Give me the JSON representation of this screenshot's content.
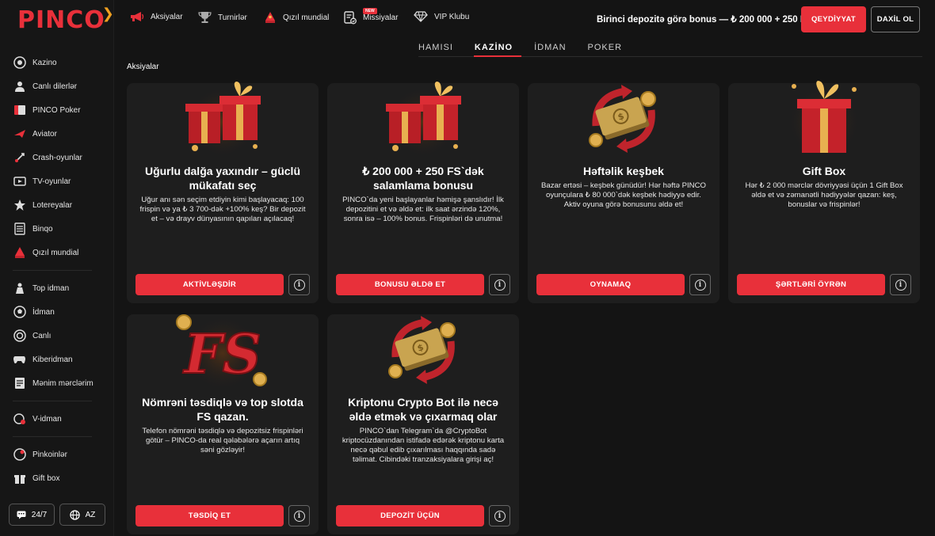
{
  "brand": {
    "logo": "PINCO"
  },
  "sidebar": {
    "items": [
      {
        "label": "Kazino",
        "icon": "casino-chip-icon"
      },
      {
        "label": "Canlı dilerlər",
        "icon": "live-dealer-icon"
      },
      {
        "label": "PINCO Poker",
        "icon": "poker-icon"
      },
      {
        "label": "Aviator",
        "icon": "plane-icon"
      },
      {
        "label": "Crash-oyunlar",
        "icon": "rocket-icon"
      },
      {
        "label": "TV-oyunlar",
        "icon": "tv-icon"
      },
      {
        "label": "Lotereyalar",
        "icon": "lottery-icon"
      },
      {
        "label": "Binqo",
        "icon": "bingo-icon"
      },
      {
        "label": "Qızıl mundial",
        "icon": "trophy-icon"
      },
      {
        "label": "Top idman",
        "icon": "top-sport-icon"
      },
      {
        "label": "İdman",
        "icon": "football-icon"
      },
      {
        "label": "Canlı",
        "icon": "live-icon"
      },
      {
        "label": "Kiberidman",
        "icon": "gamepad-icon"
      },
      {
        "label": "Mənim mərclərim",
        "icon": "bets-list-icon"
      },
      {
        "label": "V-idman",
        "icon": "virtual-sport-icon"
      },
      {
        "label": "Pinkoinlər",
        "icon": "coins-icon"
      },
      {
        "label": "Gift box",
        "icon": "gift-icon"
      }
    ],
    "support_label": "24/7",
    "lang_label": "AZ"
  },
  "header": {
    "nav": [
      {
        "label": "Aksiyalar",
        "icon": "megaphone-icon"
      },
      {
        "label": "Turnirlər",
        "icon": "trophy-icon"
      },
      {
        "label": "Qızıl mundial",
        "icon": "gold-trophy-icon"
      },
      {
        "label": "Missiyalar",
        "icon": "missions-icon",
        "badge": "NEW"
      },
      {
        "label": "VIP Klubu",
        "icon": "diamond-icon"
      }
    ],
    "bonus_text": "Birinci depozitə görə bonus — ₺ 200 000 + 250 FS",
    "register_label": "QEYDİYYAT",
    "login_label": "DAXİL OL"
  },
  "tabs": [
    "HAMISI",
    "KAZİNO",
    "İDMAN",
    "POKER"
  ],
  "active_tab": "KAZİNO",
  "breadcrumb": "Aksiyalar",
  "cards": [
    {
      "title": "Uğurlu dalğa yaxındır – güclü mükafatı seç",
      "text": "Uğur anı sən seçim etdiyin kimi başlayacaq: 100 frispin və ya ₺ 3 700-dək +100% keş? Bir depozit et – və drayv dünyasının qapıları açılacaq!",
      "button": "AKTİVLƏŞDİR",
      "art": "gift-boxes"
    },
    {
      "title": "₺ 200 000 + 250 FS`dək salamlama bonusu",
      "text": "PINCO`da yeni başlayanlar həmişə şanslıdır! İlk depozitini et və əldə et: ilk saat ərzində 120%, sonra isə – 100% bonus. Frispinləri də unutma!",
      "button": "BONUSU ƏLDƏ ET",
      "art": "gift-boxes"
    },
    {
      "title": "Həftəlik keşbek",
      "text": "Bazar ertəsi – keşbek günüdür! Hər həftə PINCO oyunçulara ₺ 80 000`dək keşbek hədiyyə edir. Aktiv oyuna görə bonusunu əldə et!",
      "button": "OYNAMAQ",
      "art": "cash-stack"
    },
    {
      "title": "Gift Box",
      "text": "Hər ₺ 2 000 mərclər dövriyyəsi üçün 1 Gift Box əldə et və zəmanətli hədiyyələr qazan: keş, bonuslar və frispinlər!",
      "button": "ŞƏRTLƏRİ ÖYRƏN",
      "art": "gift-box"
    },
    {
      "title": "Nömrəni təsdiqlə və top slotda FS qazan.",
      "text": "Telefon nömrəni təsdiqlə və depozitsiz frispinləri götür – PINCO-da real qələbələrə açarın artıq səni gözləyir!",
      "button": "TƏSDİQ ET",
      "art": "fs-letters"
    },
    {
      "title": "Kriptonu Crypto Bot ilə necə əldə etmək və çıxarmaq olar",
      "text": "PINCO`dan Telegram`da @CryptoBot kriptocüzdanından istifadə edərək kriptonu karta necə qəbul edib çıxarılması haqqında sadə təlimat. Cibindəki tranzaksiyalara girişi aç!",
      "button": "DEPOZİT ÜÇÜN",
      "art": "cash-stack"
    }
  ],
  "colors": {
    "accent": "#e8303a",
    "background": "#141414",
    "card": "#1e1e1e"
  }
}
